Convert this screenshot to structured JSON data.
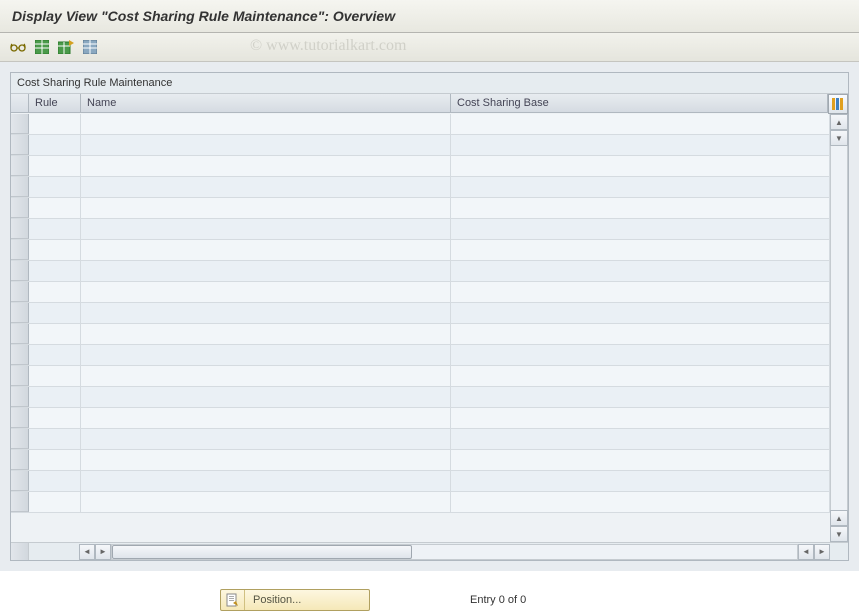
{
  "title": "Display View \"Cost Sharing Rule Maintenance\": Overview",
  "watermark": "© www.tutorialkart.com",
  "toolbar": {
    "icons": [
      "glasses-icon",
      "table-green-icon",
      "table-export-icon",
      "table-import-icon"
    ]
  },
  "panel": {
    "title": "Cost Sharing Rule Maintenance",
    "columns": {
      "rule": "Rule",
      "name": "Name",
      "base": "Cost Sharing Base"
    },
    "rows": [
      {
        "rule": "",
        "name": "",
        "base": ""
      },
      {
        "rule": "",
        "name": "",
        "base": ""
      },
      {
        "rule": "",
        "name": "",
        "base": ""
      },
      {
        "rule": "",
        "name": "",
        "base": ""
      },
      {
        "rule": "",
        "name": "",
        "base": ""
      },
      {
        "rule": "",
        "name": "",
        "base": ""
      },
      {
        "rule": "",
        "name": "",
        "base": ""
      },
      {
        "rule": "",
        "name": "",
        "base": ""
      },
      {
        "rule": "",
        "name": "",
        "base": ""
      },
      {
        "rule": "",
        "name": "",
        "base": ""
      },
      {
        "rule": "",
        "name": "",
        "base": ""
      },
      {
        "rule": "",
        "name": "",
        "base": ""
      },
      {
        "rule": "",
        "name": "",
        "base": ""
      },
      {
        "rule": "",
        "name": "",
        "base": ""
      },
      {
        "rule": "",
        "name": "",
        "base": ""
      },
      {
        "rule": "",
        "name": "",
        "base": ""
      },
      {
        "rule": "",
        "name": "",
        "base": ""
      },
      {
        "rule": "",
        "name": "",
        "base": ""
      },
      {
        "rule": "",
        "name": "",
        "base": ""
      }
    ]
  },
  "footer": {
    "position_label": "Position...",
    "entry_status": "Entry 0 of 0"
  }
}
